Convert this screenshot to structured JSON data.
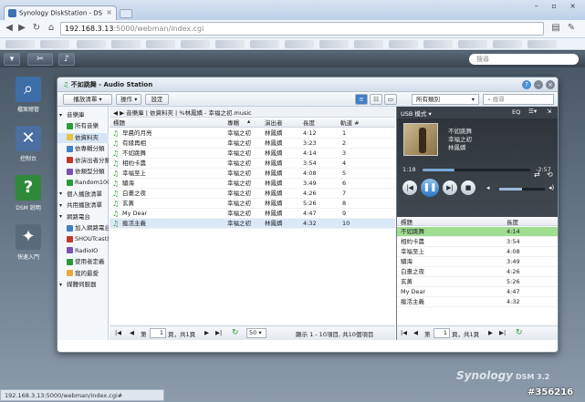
{
  "browser": {
    "tab_title": "Synology DiskStation - DS",
    "url_host": "192.168.3.13",
    "url_path": ":5000/webman/index.cgi"
  },
  "taskbar": {
    "search_placeholder": "搜尋"
  },
  "desktop_icons": [
    {
      "label": "檔案總管"
    },
    {
      "label": "控制台"
    },
    {
      "label": "DSM 說明"
    },
    {
      "label": "快速入門"
    }
  ],
  "window": {
    "title": "不如跳舞 - Audio Station",
    "toolbar": {
      "playlist": "播放清單",
      "actions": "操作",
      "settings": "設定",
      "category": "所有類別",
      "search_placeholder": "搜尋"
    }
  },
  "sidebar": {
    "items": [
      {
        "label": "音樂庫",
        "level": 0
      },
      {
        "label": "所有音樂",
        "level": 1
      },
      {
        "label": "依資料夾",
        "level": 1,
        "selected": true
      },
      {
        "label": "依專輯分類",
        "level": 1
      },
      {
        "label": "依演出者分類",
        "level": 1
      },
      {
        "label": "依類型分類",
        "level": 1
      },
      {
        "label": "Random100",
        "level": 1
      },
      {
        "label": "個人播放清單",
        "level": 0
      },
      {
        "label": "共用播放清單",
        "level": 0
      },
      {
        "label": "網路電台",
        "level": 0
      },
      {
        "label": "加入網路電台",
        "level": 1
      },
      {
        "label": "SHOUTcast(TM)",
        "level": 1
      },
      {
        "label": "RadioIO",
        "level": 1
      },
      {
        "label": "使用者定義",
        "level": 1
      },
      {
        "label": "我的最愛",
        "level": 1
      },
      {
        "label": "媒體伺服器",
        "level": 0
      }
    ]
  },
  "breadcrumb": "音樂庫 | 依資料夾 | %林鳳嬌 - 幸福之初.music",
  "song_columns": {
    "title": "標題",
    "album": "專輯",
    "artist": "演出者",
    "duration": "長度",
    "track": "軌道 #"
  },
  "songs": [
    {
      "title": "早晨的月亮",
      "album": "幸福之初",
      "artist": "林鳳嬌",
      "duration": "4:12",
      "track": "1"
    },
    {
      "title": "有緣再相",
      "album": "幸福之初",
      "artist": "林鳳嬌",
      "duration": "3:23",
      "track": "2"
    },
    {
      "title": "不如跳舞",
      "album": "幸福之初",
      "artist": "林鳳嬌",
      "duration": "4:14",
      "track": "3"
    },
    {
      "title": "相約卡農",
      "album": "幸福之初",
      "artist": "林鳳嬌",
      "duration": "3:54",
      "track": "4"
    },
    {
      "title": "幸福至上",
      "album": "幸福之初",
      "artist": "林鳳嬌",
      "duration": "4:08",
      "track": "5"
    },
    {
      "title": "驕海",
      "album": "幸福之初",
      "artist": "林鳳嬌",
      "duration": "3:49",
      "track": "6"
    },
    {
      "title": "白畫之夜",
      "album": "幸福之初",
      "artist": "林鳳嬌",
      "duration": "4:26",
      "track": "7"
    },
    {
      "title": "玄黃",
      "album": "幸福之初",
      "artist": "林鳳嬌",
      "duration": "5:26",
      "track": "8"
    },
    {
      "title": "My Dear",
      "album": "幸福之初",
      "artist": "林鳳嬌",
      "duration": "4:47",
      "track": "9"
    },
    {
      "title": "瘋活主義",
      "album": "幸福之初",
      "artist": "林鳳嬌",
      "duration": "4:32",
      "track": "10"
    }
  ],
  "pager": {
    "page_prefix": "第",
    "page": "1",
    "page_suffix": "頁，共1頁",
    "per_page": "50",
    "summary": "顯示 1 - 10項目, 共10個項目"
  },
  "player": {
    "mode": "USB 模式",
    "eq": "EQ",
    "title": "不如跳舞",
    "album": "幸福之初",
    "artist": "林鳳嬌",
    "elapsed": "1:18",
    "remaining": "-2:57",
    "progress_pct": 30,
    "volume_pct": 50
  },
  "queue_columns": {
    "title": "標題",
    "duration": "長度"
  },
  "queue": [
    {
      "title": "不如跳舞",
      "duration": "4:14",
      "playing": true
    },
    {
      "title": "相約卡農",
      "duration": "3:54"
    },
    {
      "title": "幸福至上",
      "duration": "4:08"
    },
    {
      "title": "驕海",
      "duration": "3:49"
    },
    {
      "title": "白畫之夜",
      "duration": "4:26"
    },
    {
      "title": "玄黃",
      "duration": "5:26"
    },
    {
      "title": "My Dear",
      "duration": "4:47"
    },
    {
      "title": "瘋活主義",
      "duration": "4:32"
    }
  ],
  "queue_pager": {
    "page_prefix": "第",
    "page": "1",
    "page_suffix": "頁，共1頁"
  },
  "statusbar": "192.168.3.13:5000/webman/index.cgi#",
  "branding": {
    "logo": "Synology",
    "version": "DSM 3.2"
  },
  "watermark": "#356216"
}
